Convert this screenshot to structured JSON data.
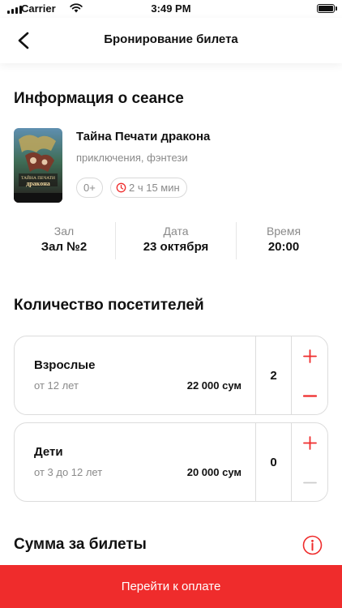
{
  "status_bar": {
    "carrier": "Carrier",
    "time": "3:49 PM"
  },
  "nav": {
    "title": "Бронирование билета",
    "back_icon": "chevron-left-icon"
  },
  "session_section": {
    "title": "Информация о сеансе"
  },
  "movie": {
    "title": "Тайна Печати дракона",
    "genres": "приключения, фэнтези",
    "age_rating": "0+",
    "duration": "2 ч 15 мин",
    "poster_text_line1": "ТАЙНА ПЕЧАТИ",
    "poster_text_line2": "дракона"
  },
  "session": {
    "hall_label": "Зал",
    "hall_value": "Зал №2",
    "date_label": "Дата",
    "date_value": "23 октября",
    "time_label": "Время",
    "time_value": "20:00"
  },
  "visitors_section": {
    "title": "Количество посетителей"
  },
  "tickets": [
    {
      "name": "Взрослые",
      "age": "от 12 лет",
      "price": "22 000 сум",
      "count": "2",
      "minus_enabled": true
    },
    {
      "name": "Дети",
      "age": "от 3 до 12 лет",
      "price": "20 000 сум",
      "count": "0",
      "minus_enabled": false
    }
  ],
  "sum_section": {
    "title": "Сумма за билеты",
    "info_icon": "info-circle-icon"
  },
  "footer": {
    "pay_label": "Перейти к оплате"
  },
  "colors": {
    "accent": "#ef2c2c",
    "muted_text": "#8a8a8a",
    "border": "#dcdcdc",
    "disabled": "#cccccc"
  }
}
